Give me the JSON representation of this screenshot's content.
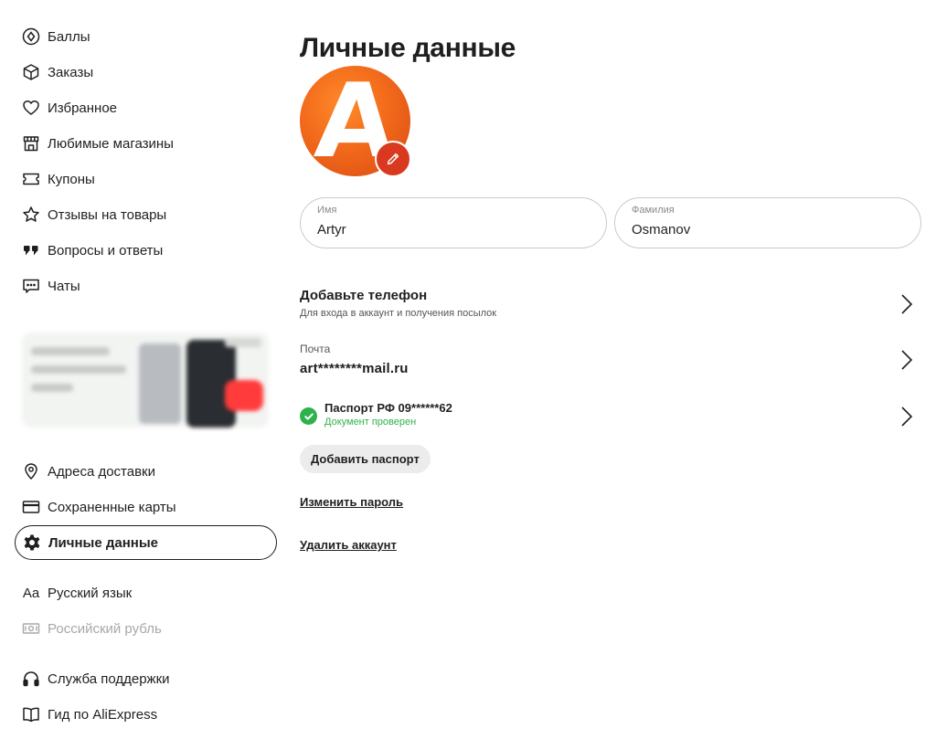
{
  "sidebar": {
    "items": [
      {
        "label": "Баллы",
        "icon": "points-icon"
      },
      {
        "label": "Заказы",
        "icon": "box-icon"
      },
      {
        "label": "Избранное",
        "icon": "heart-icon"
      },
      {
        "label": "Любимые магазины",
        "icon": "store-icon"
      },
      {
        "label": "Купоны",
        "icon": "coupon-icon"
      },
      {
        "label": "Отзывы на товары",
        "icon": "star-icon"
      },
      {
        "label": "Вопросы и ответы",
        "icon": "quote-icon"
      },
      {
        "label": "Чаты",
        "icon": "chat-icon"
      }
    ],
    "bottom_items": [
      {
        "label": "Адреса доставки",
        "icon": "location-pin-icon"
      },
      {
        "label": "Сохраненные карты",
        "icon": "card-icon"
      },
      {
        "label": "Личные данные",
        "icon": "gear-icon",
        "active": true
      },
      {
        "label": "Русский язык",
        "icon": "language-icon"
      },
      {
        "label": "Российский рубль",
        "icon": "banknote-icon",
        "muted": true
      },
      {
        "label": "Служба поддержки",
        "icon": "headphones-icon"
      },
      {
        "label": "Гид по AliExpress",
        "icon": "book-icon"
      }
    ],
    "language_icon_glyph": "Aa"
  },
  "main": {
    "title": "Личные данные",
    "avatar_letter": "A",
    "first_name": {
      "label": "Имя",
      "value": "Artyr"
    },
    "last_name": {
      "label": "Фамилия",
      "value": "Osmanov"
    },
    "phone": {
      "title": "Добавьте телефон",
      "subtitle": "Для входа в аккаунт и получения посылок"
    },
    "email": {
      "label": "Почта",
      "value": "art********mail.ru"
    },
    "passport": {
      "title": "Паспорт РФ 09******62",
      "status": "Документ проверен"
    },
    "add_passport_label": "Добавить паспорт",
    "change_password_label": "Изменить пароль",
    "delete_account_label": "Удалить аккаунт"
  },
  "colors": {
    "text": "#1f1f1f",
    "muted": "#a8a8a8",
    "success": "#2fb24c",
    "avatar_orange": "#f26a1b",
    "edit_red": "#d93a1f",
    "field_border": "#c9c9c9"
  }
}
